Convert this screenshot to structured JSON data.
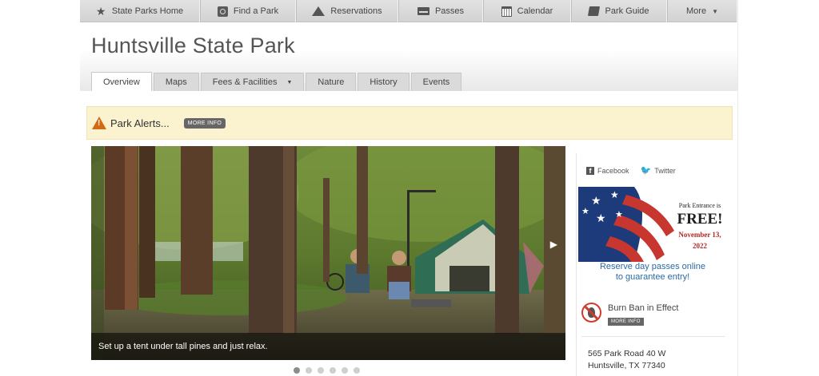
{
  "topnav": {
    "items": [
      {
        "label": "State Parks Home",
        "icon": "star-icon"
      },
      {
        "label": "Find a Park",
        "icon": "search-icon"
      },
      {
        "label": "Reservations",
        "icon": "tent-icon"
      },
      {
        "label": "Passes",
        "icon": "card-icon"
      },
      {
        "label": "Calendar",
        "icon": "calendar-icon"
      },
      {
        "label": "Park Guide",
        "icon": "book-icon"
      },
      {
        "label": "More",
        "icon": "chevron-down-icon"
      }
    ]
  },
  "header": {
    "title": "Huntsville State Park",
    "tabs": [
      {
        "label": "Overview",
        "active": true
      },
      {
        "label": "Maps"
      },
      {
        "label": "Fees & Facilities",
        "has_dropdown": true
      },
      {
        "label": "Nature"
      },
      {
        "label": "History"
      },
      {
        "label": "Events"
      }
    ]
  },
  "alert": {
    "label": "Park Alerts...",
    "button": "MORE INFO",
    "icon": "warning-icon",
    "color": "#d36b14",
    "background": "#fbf3cf"
  },
  "slider": {
    "caption": "Set up a tent under tall pines and just relax.",
    "total_slides": 6,
    "active_slide": 1
  },
  "sidebar": {
    "social": {
      "facebook": "Facebook",
      "twitter": "Twitter"
    },
    "promo": {
      "line1": "Park Entrance is",
      "free": "FREE!",
      "date_line1": "November 13,",
      "date_line2": "2022"
    },
    "reserve": {
      "line1": "Reserve day passes online",
      "line2": "to guarantee entry!"
    },
    "burn_ban": {
      "label": "Burn Ban in Effect",
      "button": "MORE INFO"
    },
    "address": {
      "line1": "565 Park Road 40 W",
      "line2": "Huntsville, TX 77340"
    }
  },
  "colors": {
    "link": "#2a6aa6",
    "promo_date": "#b32828",
    "ban": "#cf3a2c"
  }
}
